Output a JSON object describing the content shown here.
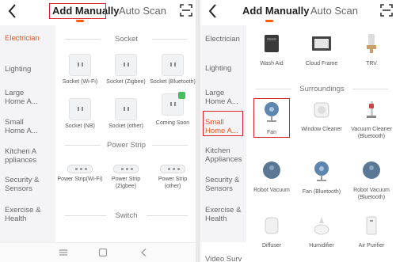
{
  "colors": {
    "accent": "#ff5a00",
    "highlight": "#d6232b",
    "active_category": "#e8541f"
  },
  "left": {
    "header": {
      "tab_manual": "Add Manually",
      "tab_auto": "Auto Scan"
    },
    "sidebar": [
      {
        "label": "Electrician",
        "active": true
      },
      {
        "label": "Lighting",
        "active": false
      },
      {
        "label": "Large Home A...",
        "active": false
      },
      {
        "label": "Small Home A...",
        "active": false
      },
      {
        "label": "Kitchen A ppliances",
        "active": false
      },
      {
        "label": "Security & Sensors",
        "active": false
      },
      {
        "label": "Exercise & Health",
        "active": false
      }
    ],
    "sections": {
      "socket": "Socket",
      "power_strip": "Power Strip",
      "switch": "Switch"
    },
    "sockets": [
      {
        "label": "Socket (Wi-Fi)"
      },
      {
        "label": "Socket (Zigbee)"
      },
      {
        "label": "Socket (Bluetooth)"
      },
      {
        "label": "Socket (NB)"
      },
      {
        "label": "Socket (other)"
      },
      {
        "label": "Coming Soon"
      }
    ],
    "strips": [
      {
        "label": "Power Strip(Wi-Fi)"
      },
      {
        "label": "Power Strip (Zigbee)"
      },
      {
        "label": "Power Strip (other)"
      }
    ]
  },
  "right": {
    "header": {
      "tab_manual": "Add Manually",
      "tab_auto": "Auto Scan"
    },
    "sidebar": [
      {
        "label": "Electrician",
        "active": false
      },
      {
        "label": "Lighting",
        "active": false
      },
      {
        "label": "Large Home A...",
        "active": false
      },
      {
        "label": "Small Home A...",
        "active": true
      },
      {
        "label": "Kitchen Appliances",
        "active": false
      },
      {
        "label": "Security & Sensors",
        "active": false
      },
      {
        "label": "Exercise & Health",
        "active": false
      },
      {
        "label": "Video Surv eillance",
        "active": false
      }
    ],
    "sections": {
      "surroundings": "Surroundings"
    },
    "top_devices": [
      {
        "label": "Wash Aid"
      },
      {
        "label": "Cloud Frame"
      },
      {
        "label": "TRV"
      }
    ],
    "surroundings": [
      {
        "label": "Fan"
      },
      {
        "label": "Window Cleaner"
      },
      {
        "label": "Vacuum Cleaner (Bluetooth)"
      },
      {
        "label": "Robot Vacuum"
      },
      {
        "label": "Fan (Bluetooth)"
      },
      {
        "label": "Robot Vacuum (Bluetooth)"
      },
      {
        "label": "Diffuser"
      },
      {
        "label": "Humidifier"
      },
      {
        "label": "Air Purifier"
      }
    ]
  },
  "icons": {
    "back": "chevron-left-icon",
    "scan": "scan-frame-icon",
    "menu": "menu-icon",
    "home": "square-home-icon",
    "nav_back": "nav-back-icon"
  }
}
